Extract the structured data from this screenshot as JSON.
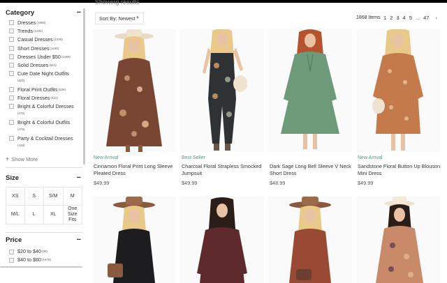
{
  "header": {
    "results_label": "Showing results"
  },
  "sidebar": {
    "category_title": "Category",
    "categories": [
      {
        "label": "Dresses",
        "count": "(1868)"
      },
      {
        "label": "Trends",
        "count": "(1405)"
      },
      {
        "label": "Casual Dresses",
        "count": "(1205)"
      },
      {
        "label": "Short Dresses",
        "count": "(1160)"
      },
      {
        "label": "Dresses Under $50",
        "count": "(1056)"
      },
      {
        "label": "Solid Dresses",
        "count": "(661)"
      },
      {
        "label": "Cute Date Night Outfits",
        "count": "(620)"
      },
      {
        "label": "Floral Print Outfits",
        "count": "(628)"
      },
      {
        "label": "Floral Dresses",
        "count": "(612)"
      },
      {
        "label": "Bright & Colorful Dresses",
        "count": "(476)"
      },
      {
        "label": "Bright & Colorful Outfits",
        "count": "(475)"
      },
      {
        "label": "Party & Cocktail Dresses",
        "count": "(428)"
      }
    ],
    "show_more": "Show More",
    "size_title": "Size",
    "sizes": [
      "XS",
      "S",
      "S/M",
      "M",
      "M/L",
      "L",
      "XL",
      "One Size Fits"
    ],
    "price_title": "Price",
    "prices": [
      {
        "label": "$20 to $40",
        "count": "(98)"
      },
      {
        "label": "$40 to $60",
        "count": "(1679)"
      }
    ]
  },
  "toolbar": {
    "sort_label": "Sort By: Newest",
    "items_count": "1868 Items",
    "pages": [
      "1",
      "2",
      "3",
      "4",
      "5",
      "...",
      "47"
    ],
    "next": "›"
  },
  "products": [
    {
      "badge": "New Arrival",
      "name": "Cinnamon Floral Print Long Sleeve Pleated Dress",
      "price": "$49.99"
    },
    {
      "badge": "Best Seller",
      "name": "Charcoal Floral Strapless Smocked Jumpsuit",
      "price": "$49.99"
    },
    {
      "badge": "",
      "name": "Dark Sage Long Bell Sleeve V Neck Short Dress",
      "price": "$48.99"
    },
    {
      "badge": "New Arrival",
      "name": "Sandstone Floral Button Up Blouson Mini Dress",
      "price": "$49.99"
    }
  ],
  "colors": {
    "badge_green": "#4b9c86",
    "text_dark": "#222222",
    "border_light": "#e3e3e3"
  }
}
